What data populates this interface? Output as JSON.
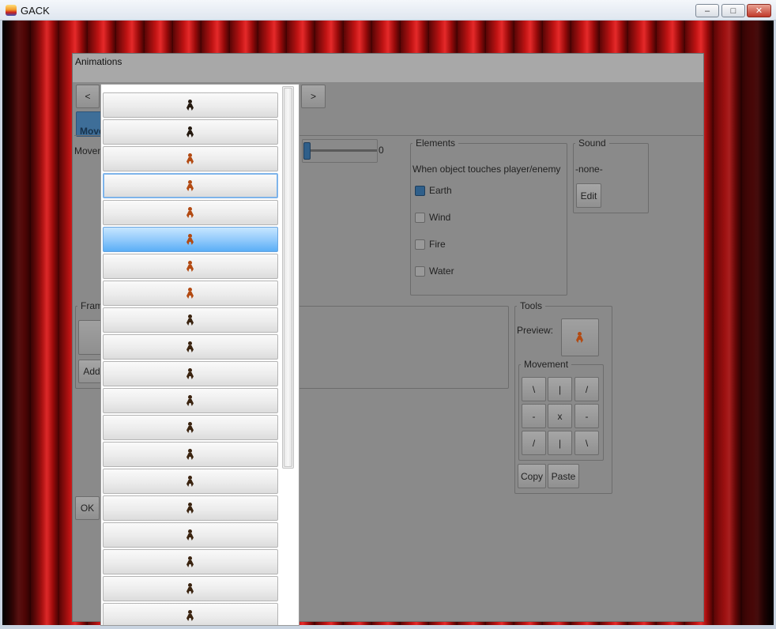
{
  "window": {
    "title": "GACK",
    "min_label": "–",
    "max_label": "□",
    "close_label": "✕"
  },
  "dialog": {
    "title": "Animations",
    "prev_label": "<",
    "next_label": ">",
    "tab_label": "Move",
    "movement_label": "Movem",
    "slider_value": "0",
    "elements": {
      "legend": "Elements",
      "description": "When object touches player/enemy",
      "items": [
        {
          "label": "Earth",
          "checked": true
        },
        {
          "label": "Wind",
          "checked": false
        },
        {
          "label": "Fire",
          "checked": false
        },
        {
          "label": "Water",
          "checked": false
        }
      ]
    },
    "sound": {
      "legend": "Sound",
      "value": "-none-",
      "edit_label": "Edit"
    },
    "frames": {
      "legend": "Fram",
      "add_label": "Add"
    },
    "tools": {
      "legend": "Tools",
      "preview_label": "Preview:",
      "movement_legend": "Movement",
      "grid": [
        "\\",
        "|",
        "/",
        "-",
        "x",
        "-",
        "/",
        "|",
        "\\"
      ],
      "copy_label": "Copy",
      "paste_label": "Paste"
    },
    "ok_label": "OK"
  },
  "popup": {
    "items": [
      {
        "sprite": "character-sprite-icon",
        "tone": "dark"
      },
      {
        "sprite": "character-sprite-icon",
        "tone": "dark"
      },
      {
        "sprite": "character-sprite-icon",
        "tone": "orange"
      },
      {
        "sprite": "character-sprite-icon",
        "tone": "orange",
        "focused": true
      },
      {
        "sprite": "character-sprite-icon",
        "tone": "orange"
      },
      {
        "sprite": "character-sprite-icon",
        "tone": "orange",
        "selected": true
      },
      {
        "sprite": "character-sprite-icon",
        "tone": "orange"
      },
      {
        "sprite": "character-sprite-icon",
        "tone": "orange"
      },
      {
        "sprite": "character-sprite-icon",
        "tone": "brown"
      },
      {
        "sprite": "character-sprite-icon",
        "tone": "brown"
      },
      {
        "sprite": "character-sprite-icon",
        "tone": "brown"
      },
      {
        "sprite": "character-sprite-icon",
        "tone": "brown"
      },
      {
        "sprite": "character-sprite-icon",
        "tone": "brown"
      },
      {
        "sprite": "character-sprite-icon",
        "tone": "brown"
      },
      {
        "sprite": "character-sprite-icon",
        "tone": "brown"
      },
      {
        "sprite": "character-sprite-icon",
        "tone": "brown"
      },
      {
        "sprite": "character-sprite-icon",
        "tone": "brown"
      },
      {
        "sprite": "character-sprite-icon",
        "tone": "brown"
      },
      {
        "sprite": "character-sprite-icon",
        "tone": "brown"
      },
      {
        "sprite": "character-sprite-icon",
        "tone": "brown"
      }
    ]
  },
  "colors": {
    "selection": "#5aaef6",
    "focus_border": "#7eb4ea",
    "curtain": "#c21414",
    "dialog_bg": "#8a8a8a"
  }
}
